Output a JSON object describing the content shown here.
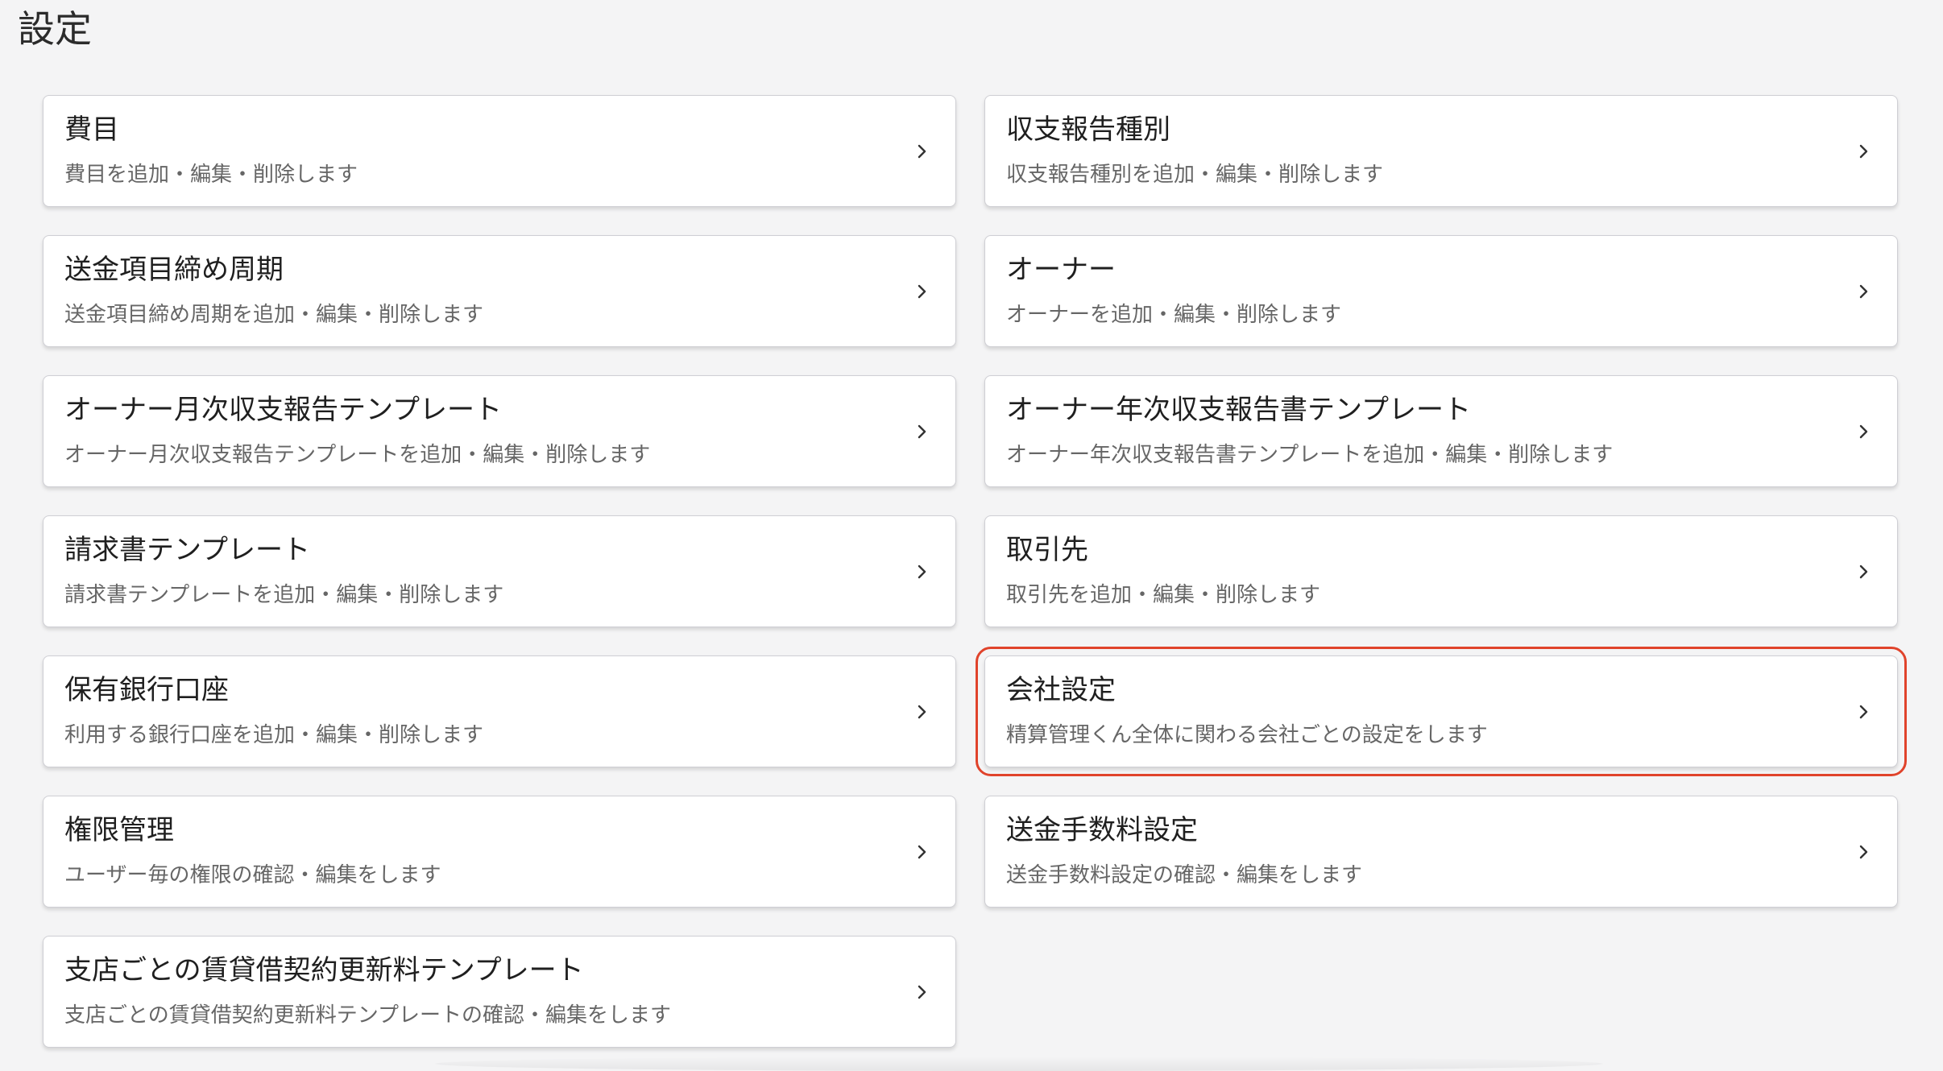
{
  "page": {
    "title": "設定"
  },
  "cards": [
    {
      "title": "費目",
      "description": "費目を追加・編集・削除します"
    },
    {
      "title": "収支報告種別",
      "description": "収支報告種別を追加・編集・削除します"
    },
    {
      "title": "送金項目締め周期",
      "description": "送金項目締め周期を追加・編集・削除します"
    },
    {
      "title": "オーナー",
      "description": "オーナーを追加・編集・削除します"
    },
    {
      "title": "オーナー月次収支報告テンプレート",
      "description": "オーナー月次収支報告テンプレートを追加・編集・削除します"
    },
    {
      "title": "オーナー年次収支報告書テンプレート",
      "description": "オーナー年次収支報告書テンプレートを追加・編集・削除します"
    },
    {
      "title": "請求書テンプレート",
      "description": "請求書テンプレートを追加・編集・削除します"
    },
    {
      "title": "取引先",
      "description": "取引先を追加・編集・削除します"
    },
    {
      "title": "保有銀行口座",
      "description": "利用する銀行口座を追加・編集・削除します"
    },
    {
      "title": "会社設定",
      "description": "精算管理くん全体に関わる会社ごとの設定をします"
    },
    {
      "title": "権限管理",
      "description": "ユーザー毎の権限の確認・編集をします"
    },
    {
      "title": "送金手数料設定",
      "description": "送金手数料設定の確認・編集をします"
    },
    {
      "title": "支店ごとの賃貸借契約更新料テンプレート",
      "description": "支店ごとの賃貸借契約更新料テンプレートの確認・編集をします"
    }
  ],
  "icons": {
    "card_arrow": "chevron-right-icon"
  },
  "colors": {
    "highlight": "#e0432b",
    "card_border": "#cfcfd4",
    "background": "#f4f4f5"
  }
}
